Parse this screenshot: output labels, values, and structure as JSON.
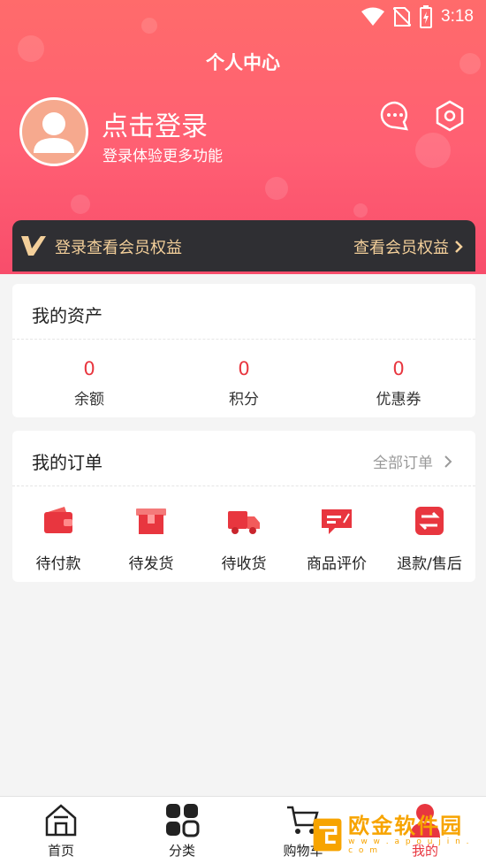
{
  "status_bar": {
    "time": "3:18"
  },
  "header": {
    "title": "个人中心",
    "login_title": "点击登录",
    "login_subtitle": "登录体验更多功能"
  },
  "vip": {
    "left_text": "登录查看会员权益",
    "right_text": "查看会员权益"
  },
  "assets": {
    "title": "我的资产",
    "items": [
      {
        "value": "0",
        "label": "余额"
      },
      {
        "value": "0",
        "label": "积分"
      },
      {
        "value": "0",
        "label": "优惠券"
      }
    ]
  },
  "orders": {
    "title": "我的订单",
    "all_label": "全部订单",
    "items": [
      {
        "label": "待付款",
        "icon": "wallet-icon"
      },
      {
        "label": "待发货",
        "icon": "package-icon"
      },
      {
        "label": "待收货",
        "icon": "truck-icon"
      },
      {
        "label": "商品评价",
        "icon": "comment-icon"
      },
      {
        "label": "退款/售后",
        "icon": "exchange-icon"
      }
    ]
  },
  "tabbar": {
    "items": [
      {
        "label": "首页",
        "icon": "home-icon"
      },
      {
        "label": "分类",
        "icon": "grid-icon"
      },
      {
        "label": "购物车",
        "icon": "cart-icon"
      },
      {
        "label": "我的",
        "icon": "user-icon",
        "active": true
      }
    ]
  },
  "watermark": {
    "text": "欧金软件园",
    "sub": "w w w . a p o u j i n . c o m"
  },
  "colors": {
    "accent": "#e8363f",
    "header": "#ff6b6b",
    "vip_gold": "#f3cf9a"
  }
}
